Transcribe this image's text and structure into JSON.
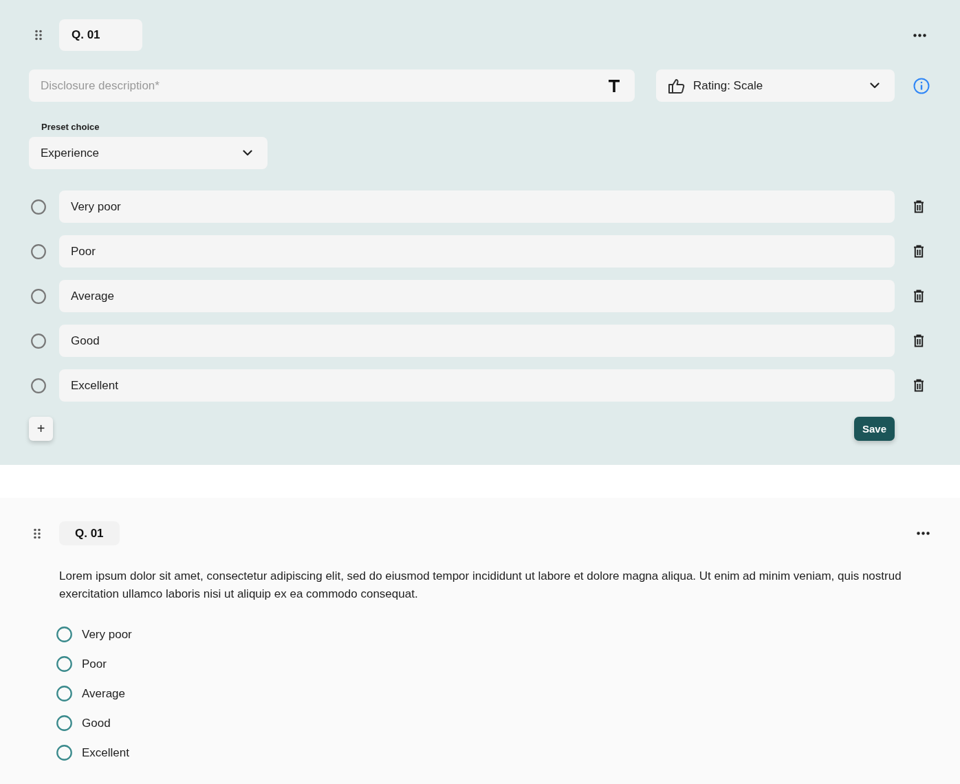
{
  "editor": {
    "question_label": "Q. 01",
    "description": {
      "placeholder": "Disclosure description*"
    },
    "answer_type": {
      "value": "Rating: Scale"
    },
    "preset": {
      "label": "Preset choice",
      "value": "Experience"
    },
    "options": [
      {
        "text": "Very poor",
        "selected": false
      },
      {
        "text": "Poor",
        "selected": false
      },
      {
        "text": "Average",
        "selected": false
      },
      {
        "text": "Good",
        "selected": false
      },
      {
        "text": "Excellent",
        "selected": false
      }
    ],
    "add_label": "+",
    "save_label": "Save"
  },
  "preview": {
    "question_label": "Q. 01",
    "text": "Lorem ipsum dolor sit amet, consectetur adipiscing elit, sed do eiusmod tempor incididunt ut labore et dolore magna aliqua. Ut enim ad minim veniam, quis nostrud exercitation ullamco laboris nisi ut aliquip ex ea commodo consequat.",
    "options": [
      {
        "text": "Very poor",
        "selected": false
      },
      {
        "text": "Poor",
        "selected": false
      },
      {
        "text": "Average",
        "selected": false
      },
      {
        "text": "Good",
        "selected": false
      },
      {
        "text": "Excellent",
        "selected": false
      }
    ]
  }
}
